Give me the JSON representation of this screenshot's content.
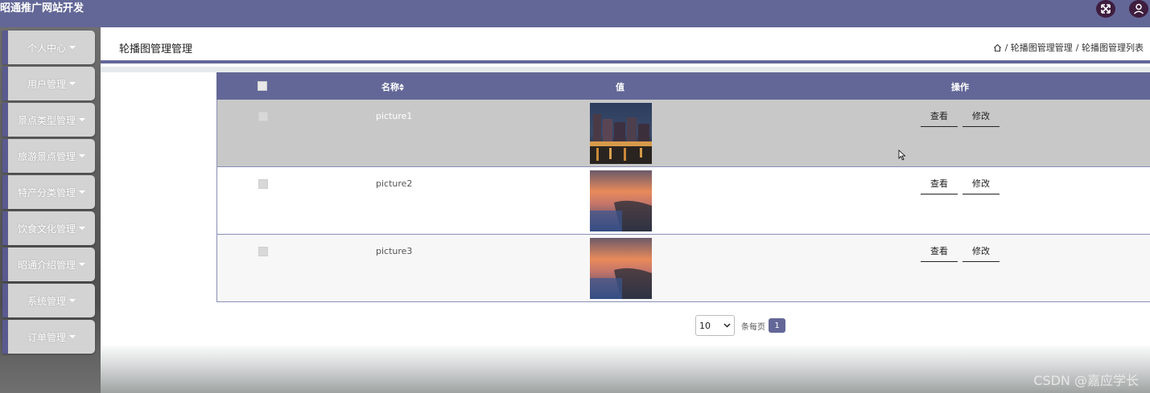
{
  "app": {
    "title": "昭通推广网站开发"
  },
  "topbar": {
    "fullscreen_icon": "expand-arrows-icon",
    "user_icon": "user-icon"
  },
  "sidebar": {
    "items": [
      {
        "label": "个人中心"
      },
      {
        "label": "用户管理"
      },
      {
        "label": "景点类型管理"
      },
      {
        "label": "旅游景点管理"
      },
      {
        "label": "特产分类管理"
      },
      {
        "label": "饮食文化管理"
      },
      {
        "label": "昭通介绍管理"
      },
      {
        "label": "系统管理"
      },
      {
        "label": "订单管理"
      }
    ]
  },
  "page": {
    "title": "轮播图管理管理",
    "breadcrumb": {
      "home_icon": "home-icon",
      "level1": "/ 轮播图管理管理",
      "level2": "/ 轮播图管理列表"
    }
  },
  "table": {
    "columns": {
      "name": "名称",
      "value": "值",
      "actions": "操作"
    },
    "sort_icon": "sort-arrows-icon",
    "rows": [
      {
        "name": "picture1",
        "image": "night-city-river-photo",
        "view": "查看",
        "edit": "修改"
      },
      {
        "name": "picture2",
        "image": "sunset-lake-photo",
        "view": "查看",
        "edit": "修改"
      },
      {
        "name": "picture3",
        "image": "sunset-lake-photo",
        "view": "查看",
        "edit": "修改"
      }
    ]
  },
  "pagination": {
    "page_size": "10",
    "per_page_label": "条每页",
    "current_page": "1"
  },
  "watermark": "CSDN @嘉应学长",
  "colors": {
    "topbar": "#636797",
    "accent": "#636797",
    "row_hover": "#c8c8c8"
  }
}
